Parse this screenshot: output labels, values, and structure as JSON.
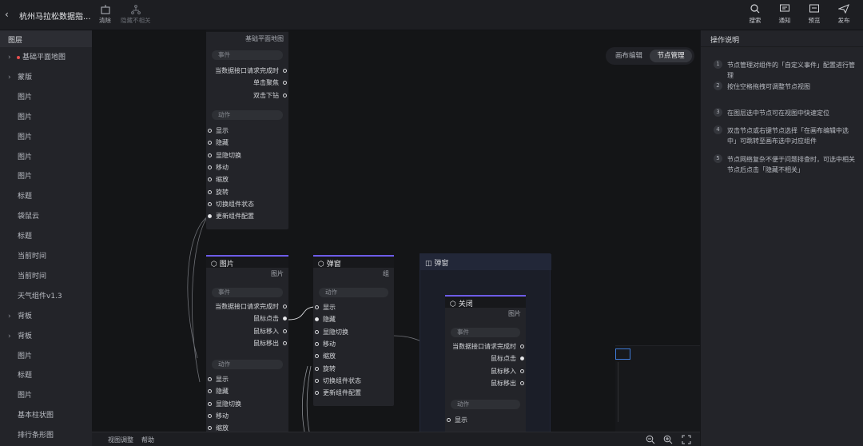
{
  "topbar": {
    "back_icon": "chevron-left-icon",
    "title": "杭州马拉松数据指...",
    "clear_label": "清除",
    "hide_unrelated_label": "隐藏不相关",
    "search_label": "搜索",
    "notify_label": "通知",
    "preview_label": "预览",
    "publish_label": "发布"
  },
  "layers": {
    "header": "图层",
    "items": [
      {
        "label": "基础平面地图",
        "arrow": true,
        "dot": true
      },
      {
        "label": "蒙版",
        "arrow": true
      },
      {
        "label": "图片"
      },
      {
        "label": "图片"
      },
      {
        "label": "图片"
      },
      {
        "label": "图片"
      },
      {
        "label": "图片"
      },
      {
        "label": "标题"
      },
      {
        "label": "袋鼠云"
      },
      {
        "label": "标题"
      },
      {
        "label": "当前时间"
      },
      {
        "label": "当前时间"
      },
      {
        "label": "天气组件v1.3"
      },
      {
        "label": "背板",
        "arrow": true
      },
      {
        "label": "背板",
        "arrow": true
      },
      {
        "label": "图片"
      },
      {
        "label": "标题"
      },
      {
        "label": "图片"
      },
      {
        "label": "基本柱状图"
      },
      {
        "label": "排行条形图"
      }
    ]
  },
  "canvas": {
    "tabs": {
      "canvas_edit": "画布编辑",
      "node_manage": "节点管理"
    },
    "bottom": {
      "view_adjust": "视图调整",
      "help": "帮助"
    }
  },
  "nodes": {
    "map": {
      "sub": "基础平面地图",
      "event_pill": "事件",
      "events": [
        "当数据接口请求完成时",
        "单击聚焦",
        "双击下钻"
      ],
      "action_pill": "动作",
      "actions": [
        "显示",
        "隐藏",
        "显隐切换",
        "移动",
        "缩放",
        "旋转",
        "切换组件状态",
        "更新组件配置"
      ]
    },
    "image": {
      "title": "图片",
      "sub": "图片",
      "event_pill": "事件",
      "events": [
        "当数据接口请求完成时",
        "鼠标点击",
        "鼠标移入",
        "鼠标移出"
      ],
      "action_pill": "动作",
      "actions": [
        "显示",
        "隐藏",
        "显隐切换",
        "移动",
        "缩放"
      ]
    },
    "popup": {
      "title": "弹窗",
      "sub": "组",
      "action_pill": "动作",
      "actions": [
        "显示",
        "隐藏",
        "显隐切换",
        "移动",
        "缩放",
        "旋转",
        "切换组件状态",
        "更新组件配置"
      ]
    },
    "group_title": "弹窗",
    "close": {
      "title": "关闭",
      "sub": "图片",
      "event_pill": "事件",
      "events": [
        "当数据接口请求完成时",
        "鼠标点击",
        "鼠标移入",
        "鼠标移出"
      ],
      "action_pill": "动作",
      "actions": [
        "显示"
      ]
    }
  },
  "help": {
    "header": "操作说明",
    "steps": [
      {
        "n": "1",
        "text": "节点管理对组件的「自定义事件」配置进行管理"
      },
      {
        "n": "2",
        "text": "按住空格拖拽可调整节点视图"
      },
      {
        "n": "3",
        "text": "在图层选中节点可在视图中快速定位"
      },
      {
        "n": "4",
        "text": "双击节点或右键节点选择「在画布编辑中选中」可跳转至画布选中对应组件"
      },
      {
        "n": "5",
        "text": "节点网络复杂不便于问题排查时，可选中相关节点后点击「隐藏不相关」"
      }
    ]
  },
  "colors": {
    "accent": "#6d5ce8",
    "danger": "#e64f4f"
  }
}
